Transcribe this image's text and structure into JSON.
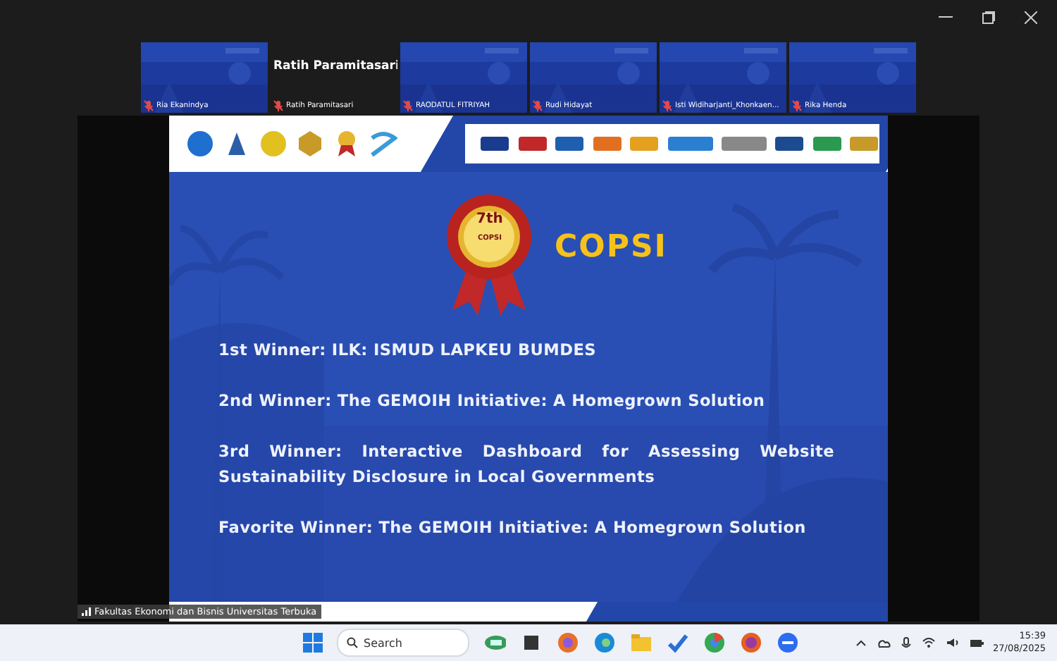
{
  "participants": [
    {
      "kind": "video",
      "name": "Ria Ekanindya",
      "muted": true
    },
    {
      "kind": "name-card",
      "card_name": "Ratih Paramitasari",
      "name": "Ratih Paramitasari",
      "muted": true
    },
    {
      "kind": "video",
      "name": "RAODATUL FITRIYAH",
      "muted": true
    },
    {
      "kind": "video",
      "name": "Rudi Hidayat",
      "muted": true
    },
    {
      "kind": "video",
      "name": "Isti Widiharjanti_Khonkaen...",
      "muted": true
    },
    {
      "kind": "video",
      "name": "Rika Henda",
      "muted": true
    }
  ],
  "slide": {
    "badge": {
      "ordinal": "7th",
      "label": "COPSI"
    },
    "title": "COPSI",
    "winners": [
      "1st Winner: ILK: ISMUD LAPKEU BUMDES",
      "2nd Winner: The GEMOIH Initiative: A Homegrown Solution",
      "3rd Winner: Interactive Dashboard for Assessing Website Sustainability Disclosure in Local Governments",
      "Favorite Winner: The GEMOIH Initiative: A Homegrown Solution"
    ]
  },
  "speaker_label": "Fakultas Ekonomi dan Bisnis Universitas Terbuka",
  "taskbar": {
    "search_placeholder": "Search",
    "time": "15:39",
    "date": "27/08/2025"
  }
}
